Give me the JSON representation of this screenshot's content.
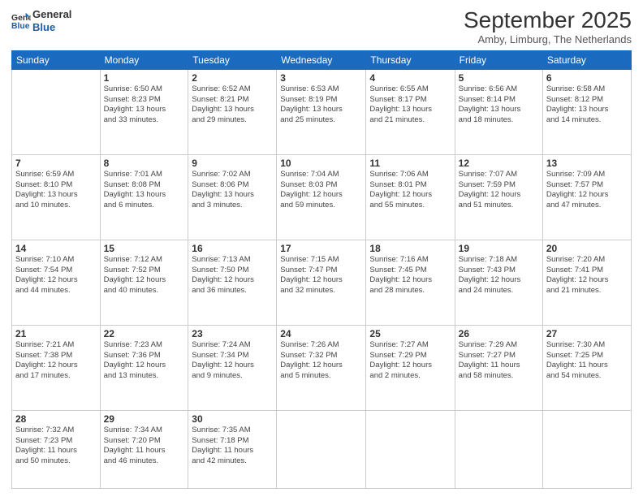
{
  "header": {
    "logo_line1": "General",
    "logo_line2": "Blue",
    "title": "September 2025",
    "subtitle": "Amby, Limburg, The Netherlands"
  },
  "days_of_week": [
    "Sunday",
    "Monday",
    "Tuesday",
    "Wednesday",
    "Thursday",
    "Friday",
    "Saturday"
  ],
  "weeks": [
    [
      {
        "day": "",
        "info": ""
      },
      {
        "day": "1",
        "info": "Sunrise: 6:50 AM\nSunset: 8:23 PM\nDaylight: 13 hours\nand 33 minutes."
      },
      {
        "day": "2",
        "info": "Sunrise: 6:52 AM\nSunset: 8:21 PM\nDaylight: 13 hours\nand 29 minutes."
      },
      {
        "day": "3",
        "info": "Sunrise: 6:53 AM\nSunset: 8:19 PM\nDaylight: 13 hours\nand 25 minutes."
      },
      {
        "day": "4",
        "info": "Sunrise: 6:55 AM\nSunset: 8:17 PM\nDaylight: 13 hours\nand 21 minutes."
      },
      {
        "day": "5",
        "info": "Sunrise: 6:56 AM\nSunset: 8:14 PM\nDaylight: 13 hours\nand 18 minutes."
      },
      {
        "day": "6",
        "info": "Sunrise: 6:58 AM\nSunset: 8:12 PM\nDaylight: 13 hours\nand 14 minutes."
      }
    ],
    [
      {
        "day": "7",
        "info": "Sunrise: 6:59 AM\nSunset: 8:10 PM\nDaylight: 13 hours\nand 10 minutes."
      },
      {
        "day": "8",
        "info": "Sunrise: 7:01 AM\nSunset: 8:08 PM\nDaylight: 13 hours\nand 6 minutes."
      },
      {
        "day": "9",
        "info": "Sunrise: 7:02 AM\nSunset: 8:06 PM\nDaylight: 13 hours\nand 3 minutes."
      },
      {
        "day": "10",
        "info": "Sunrise: 7:04 AM\nSunset: 8:03 PM\nDaylight: 12 hours\nand 59 minutes."
      },
      {
        "day": "11",
        "info": "Sunrise: 7:06 AM\nSunset: 8:01 PM\nDaylight: 12 hours\nand 55 minutes."
      },
      {
        "day": "12",
        "info": "Sunrise: 7:07 AM\nSunset: 7:59 PM\nDaylight: 12 hours\nand 51 minutes."
      },
      {
        "day": "13",
        "info": "Sunrise: 7:09 AM\nSunset: 7:57 PM\nDaylight: 12 hours\nand 47 minutes."
      }
    ],
    [
      {
        "day": "14",
        "info": "Sunrise: 7:10 AM\nSunset: 7:54 PM\nDaylight: 12 hours\nand 44 minutes."
      },
      {
        "day": "15",
        "info": "Sunrise: 7:12 AM\nSunset: 7:52 PM\nDaylight: 12 hours\nand 40 minutes."
      },
      {
        "day": "16",
        "info": "Sunrise: 7:13 AM\nSunset: 7:50 PM\nDaylight: 12 hours\nand 36 minutes."
      },
      {
        "day": "17",
        "info": "Sunrise: 7:15 AM\nSunset: 7:47 PM\nDaylight: 12 hours\nand 32 minutes."
      },
      {
        "day": "18",
        "info": "Sunrise: 7:16 AM\nSunset: 7:45 PM\nDaylight: 12 hours\nand 28 minutes."
      },
      {
        "day": "19",
        "info": "Sunrise: 7:18 AM\nSunset: 7:43 PM\nDaylight: 12 hours\nand 24 minutes."
      },
      {
        "day": "20",
        "info": "Sunrise: 7:20 AM\nSunset: 7:41 PM\nDaylight: 12 hours\nand 21 minutes."
      }
    ],
    [
      {
        "day": "21",
        "info": "Sunrise: 7:21 AM\nSunset: 7:38 PM\nDaylight: 12 hours\nand 17 minutes."
      },
      {
        "day": "22",
        "info": "Sunrise: 7:23 AM\nSunset: 7:36 PM\nDaylight: 12 hours\nand 13 minutes."
      },
      {
        "day": "23",
        "info": "Sunrise: 7:24 AM\nSunset: 7:34 PM\nDaylight: 12 hours\nand 9 minutes."
      },
      {
        "day": "24",
        "info": "Sunrise: 7:26 AM\nSunset: 7:32 PM\nDaylight: 12 hours\nand 5 minutes."
      },
      {
        "day": "25",
        "info": "Sunrise: 7:27 AM\nSunset: 7:29 PM\nDaylight: 12 hours\nand 2 minutes."
      },
      {
        "day": "26",
        "info": "Sunrise: 7:29 AM\nSunset: 7:27 PM\nDaylight: 11 hours\nand 58 minutes."
      },
      {
        "day": "27",
        "info": "Sunrise: 7:30 AM\nSunset: 7:25 PM\nDaylight: 11 hours\nand 54 minutes."
      }
    ],
    [
      {
        "day": "28",
        "info": "Sunrise: 7:32 AM\nSunset: 7:23 PM\nDaylight: 11 hours\nand 50 minutes."
      },
      {
        "day": "29",
        "info": "Sunrise: 7:34 AM\nSunset: 7:20 PM\nDaylight: 11 hours\nand 46 minutes."
      },
      {
        "day": "30",
        "info": "Sunrise: 7:35 AM\nSunset: 7:18 PM\nDaylight: 11 hours\nand 42 minutes."
      },
      {
        "day": "",
        "info": ""
      },
      {
        "day": "",
        "info": ""
      },
      {
        "day": "",
        "info": ""
      },
      {
        "day": "",
        "info": ""
      }
    ]
  ]
}
